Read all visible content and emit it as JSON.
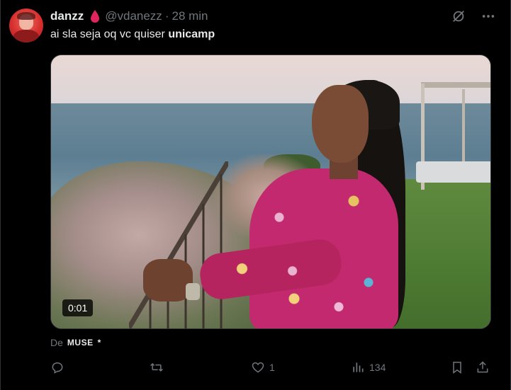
{
  "author": {
    "name": "danzz",
    "handle": "@vdanezz",
    "separator": "·",
    "time": "28 min"
  },
  "tweet": {
    "text_plain": "ai sla seja oq vc quiser ",
    "text_bold": "unicamp"
  },
  "media": {
    "video_timestamp": "0:01"
  },
  "source": {
    "prefix": "De",
    "name": "MUSE",
    "suffix": "*"
  },
  "actions": {
    "reply": {
      "icon": "reply-icon",
      "count": ""
    },
    "retweet": {
      "icon": "retweet-icon",
      "count": ""
    },
    "like": {
      "icon": "heart-icon",
      "count": "1"
    },
    "views": {
      "icon": "views-icon",
      "count": "134"
    },
    "bookmark": {
      "icon": "bookmark-icon"
    },
    "share": {
      "icon": "share-icon"
    }
  },
  "colors": {
    "background": "#000000",
    "text": "#e7e9ea",
    "secondary": "#71767b",
    "drop": "#e0245e"
  }
}
